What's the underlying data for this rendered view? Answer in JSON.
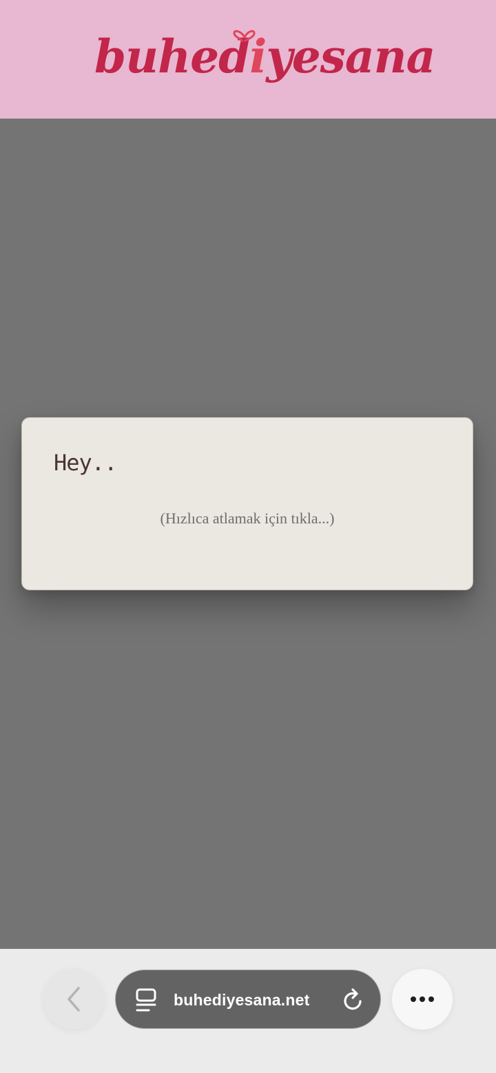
{
  "header": {
    "logo_text_before": "buhed",
    "logo_text_accent": "i",
    "logo_text_after": "yesana",
    "logo_color": "#c2264a",
    "accent_color": "#e0465b",
    "background": "#e8b7d1"
  },
  "card": {
    "title": "Hey..",
    "hint": "(Hızlıca atlamak için tıkla...)"
  },
  "browser_toolbar": {
    "back_icon": "chevron-left-icon",
    "tabs_icon": "tabs-icon",
    "url": "buhediyesana.net",
    "reload_icon": "reload-icon",
    "more_icon": "more-icon"
  }
}
